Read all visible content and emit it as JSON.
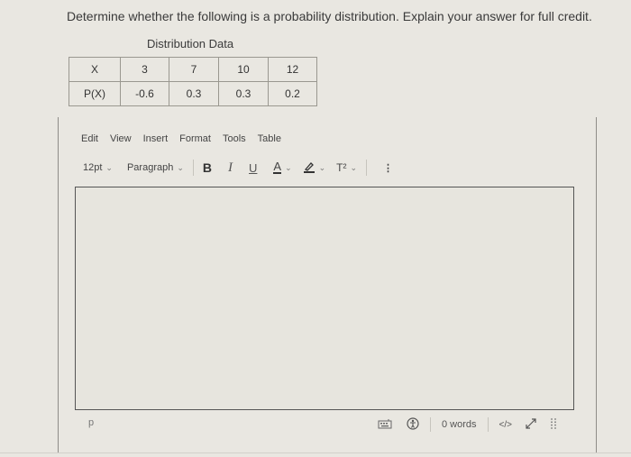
{
  "question": "Determine whether the following is a probability distribution. Explain your answer for full credit.",
  "table": {
    "caption": "Distribution Data",
    "rows": [
      {
        "label": "X",
        "values": [
          "3",
          "7",
          "10",
          "12"
        ]
      },
      {
        "label": "P(X)",
        "values": [
          "-0.6",
          "0.3",
          "0.3",
          "0.2"
        ]
      }
    ]
  },
  "editor": {
    "menu": [
      "Edit",
      "View",
      "Insert",
      "Format",
      "Tools",
      "Table"
    ],
    "toolbar": {
      "font_size": "12pt",
      "block_format": "Paragraph",
      "bold": "B",
      "italic": "I",
      "underline": "U",
      "text_color": "A",
      "superscript": "T²",
      "more": "⋮"
    },
    "content": "",
    "status": {
      "path": "p",
      "word_count": "0 words",
      "html_toggle": "</>"
    }
  }
}
